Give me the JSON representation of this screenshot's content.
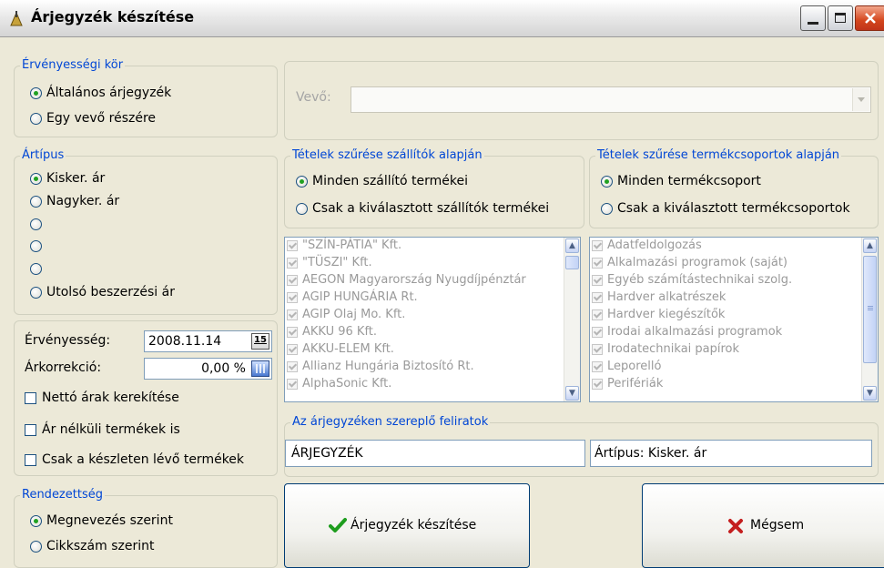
{
  "window": {
    "title": "Árjegyzék készítése"
  },
  "validity_group": {
    "title": "Érvényességi kör",
    "options": [
      "Általános árjegyzék",
      "Egy vevő részére"
    ],
    "selected": 0
  },
  "customer": {
    "label": "Vevő:",
    "value": ""
  },
  "price_type_group": {
    "title": "Ártípus",
    "options": [
      "Kisker. ár",
      "Nagyker. ár",
      "",
      "",
      "",
      "Utolsó beszerzési ár"
    ],
    "selected": 0
  },
  "supplier_filter": {
    "title": "Tételek szűrése szállítók alapján",
    "options": [
      "Minden szállító termékei",
      "Csak a kiválasztott szállítók termékei"
    ],
    "selected": 0,
    "items": [
      "\"SZÍN-PÁTIA\" Kft.",
      "\"TÜSZI\" Kft.",
      "AEGON Magyarország Nyugdíjpénztár",
      "AGIP HUNGÁRIA Rt.",
      "AGIP Olaj Mo. Kft.",
      "AKKU 96 Kft.",
      "AKKU-ELEM Kft.",
      "Allianz Hungária Biztosító Rt.",
      "AlphaSonic Kft."
    ]
  },
  "group_filter": {
    "title": "Tételek szűrése termékcsoportok alapján",
    "options": [
      "Minden termékcsoport",
      "Csak a kiválasztott termékcsoportok"
    ],
    "selected": 0,
    "items": [
      "Adatfeldolgozás",
      "Alkalmazási programok (saját)",
      "Egyéb számítástechnikai szolg.",
      "Hardver alkatrészek",
      "Hardver kiegészítők",
      "Irodai alkalmazási programok",
      "Irodatechnikai papírok",
      "Leporelló",
      "Perifériák"
    ]
  },
  "settings": {
    "validity_label": "Érvényesség:",
    "validity_value": "2008.11.14",
    "validity_button": "15",
    "correction_label": "Árkorrekció:",
    "correction_value": "0,00 %",
    "checkboxes": [
      "Nettó árak kerekítése",
      "Ár nélküli termékek is",
      "Csak a készleten lévő termékek"
    ]
  },
  "captions": {
    "title": "Az árjegyzéken szereplő feliratok",
    "left_value": "ÁRJEGYZÉK",
    "right_value": "Ártípus: Kisker. ár"
  },
  "sorting": {
    "title": "Rendezettség",
    "options": [
      "Megnevezés szerint",
      "Cikkszám szerint"
    ],
    "selected": 0
  },
  "buttons": {
    "create": "Árjegyzék készítése",
    "cancel": "Mégsem"
  },
  "colors": {
    "group_title": "#0046d5",
    "radio_dot": "#21a121",
    "window_bg": "#ece9d8",
    "close_button": "#d4461d"
  }
}
